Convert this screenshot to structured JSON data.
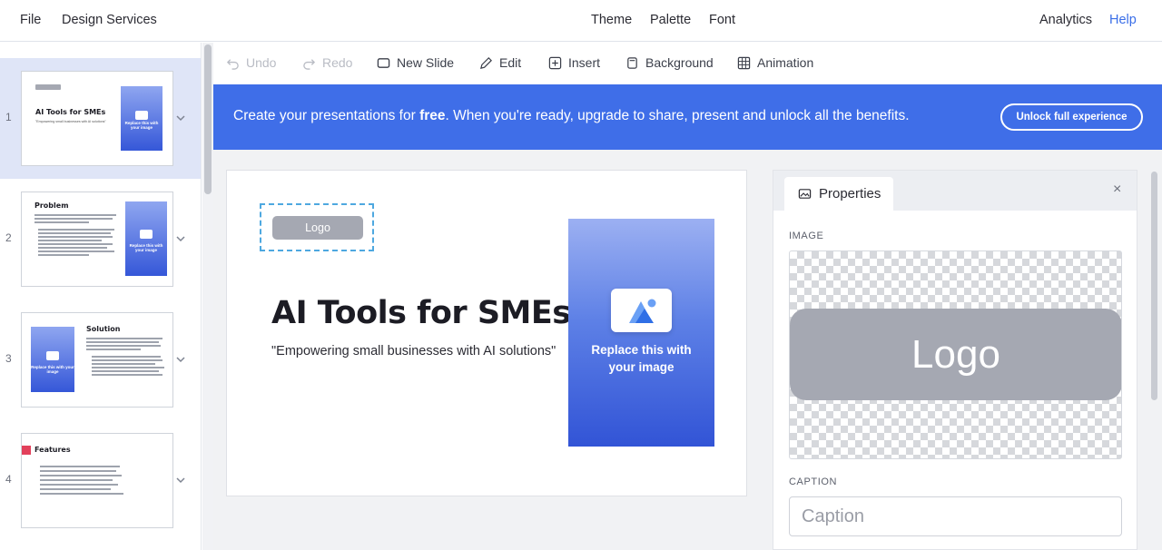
{
  "menubar": {
    "file": "File",
    "design_services": "Design Services",
    "theme": "Theme",
    "palette": "Palette",
    "font": "Font",
    "analytics": "Analytics",
    "help": "Help"
  },
  "toolbar": {
    "undo": "Undo",
    "redo": "Redo",
    "new_slide": "New Slide",
    "edit": "Edit",
    "insert": "Insert",
    "background": "Background",
    "animation": "Animation"
  },
  "banner": {
    "msg_before": "Create your presentations for ",
    "msg_bold": "free",
    "msg_after": ". When you're ready, upgrade to share, present and unlock all the benefits.",
    "unlock_label": "Unlock full experience"
  },
  "thumbnails": [
    {
      "num": "1",
      "title": "AI Tools for SMEs",
      "subtitle": "\"Empowering small businesses with AI solutions\"",
      "img_caption": "Replace this with your image"
    },
    {
      "num": "2",
      "title": "Problem",
      "img_caption": "Replace this with your image"
    },
    {
      "num": "3",
      "title": "Solution",
      "img_caption": "Replace this with your image"
    },
    {
      "num": "4",
      "title": "Features"
    }
  ],
  "slide": {
    "logo_text": "Logo",
    "title": "AI Tools for SMEs",
    "subtitle": "\"Empowering small businesses with AI solutions\"",
    "image_caption_line1": "Replace this with",
    "image_caption_line2": "your image"
  },
  "properties": {
    "tab_label": "Properties",
    "close_symbol": "×",
    "image_label": "IMAGE",
    "preview_logo_text": "Logo",
    "caption_label": "CAPTION",
    "caption_placeholder": "Caption"
  },
  "colors": {
    "accent": "#3f6ee8",
    "help_link": "#3a6ee8",
    "selection_dash": "#4ea8e0",
    "thumb_active": "#dfe5f7",
    "features_marker": "#e2405b"
  }
}
